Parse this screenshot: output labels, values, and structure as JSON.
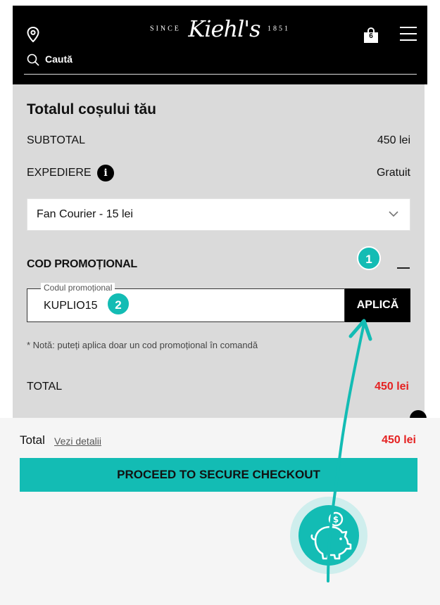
{
  "header": {
    "brand_since": "SINCE",
    "brand_name": "Kiehl's",
    "brand_year": "1851",
    "bag_count": "6",
    "search_label": "Caută"
  },
  "summary": {
    "title": "Totalul coșului tău",
    "subtotal_label": "SUBTOTAL",
    "subtotal_value": "450 lei",
    "shipping_label": "EXPEDIERE",
    "shipping_value": "Gratuit",
    "shipping_option": "Fan Courier - 15 lei",
    "promo_heading": "COD PROMOȚIONAL",
    "promo_field_label": "Codul promoțional",
    "promo_value": "KUPLIO15",
    "apply_label": "APLICĂ",
    "note": "* Notă: puteți aplica doar un cod promoțional în comandă",
    "total_label": "TOTAL",
    "total_value": "450 lei"
  },
  "steps": {
    "one": "1",
    "two": "2"
  },
  "bottom_bar": {
    "total_label": "Total",
    "details_link": "Vezi detalii",
    "total_value": "450 lei",
    "checkout_label": "PROCEED TO SECURE CHECKOUT"
  },
  "colors": {
    "accent": "#13bcb4",
    "price_red": "#e52222",
    "header_bg": "#000000",
    "panel_bg": "#dadada"
  },
  "icons": [
    "location-pin-icon",
    "shopping-bag-icon",
    "hamburger-menu-icon",
    "search-icon",
    "info-icon",
    "chevron-down-icon",
    "piggy-bank-icon",
    "arrow-icon"
  ]
}
